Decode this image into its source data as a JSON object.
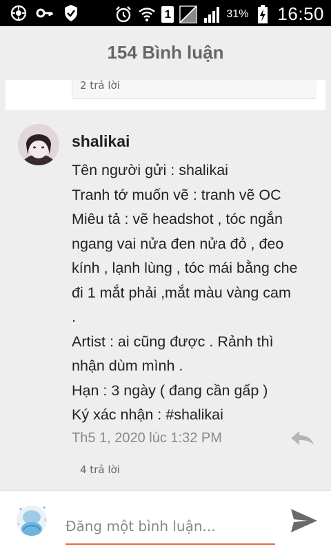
{
  "status_bar": {
    "sim_number": "1",
    "battery": "31%",
    "time": "16:50",
    "icons": [
      "settings-gear-icon",
      "key-icon",
      "shield-check-icon",
      "alarm-icon",
      "wifi-icon",
      "sim-1-icon",
      "no-signal-icon",
      "signal-icon",
      "battery-charging-icon"
    ]
  },
  "header": {
    "title": "154 Bình luận"
  },
  "previous_comment": {
    "reply_count": "2 trả lời"
  },
  "comment": {
    "author": "shalikai",
    "lines": [
      "Tên người gửi : shalikai",
      "Tranh tớ muốn vẽ : tranh vẽ OC",
      "Miêu tả : vẽ headshot , tóc ngắn",
      "ngang vai nửa đen nửa đỏ , đeo",
      "kính , lạnh lùng , tóc mái bằng che",
      "đi 1 mắt phải ,mắt màu vàng cam",
      ".",
      "Artist : ai cũng được . Rảnh thì",
      "nhận dùm mình .",
      "Hạn : 3 ngày ( đang cần gấp )",
      "Ký xác nhận : #shalikai"
    ],
    "timestamp": "Th5 1, 2020 lúc 1:32 PM",
    "reply_count": "4 trả lời",
    "reply_icon": "reply-arrow-icon"
  },
  "compose": {
    "placeholder": "Đăng một bình luận...",
    "send_icon": "send-icon"
  },
  "colors": {
    "accent": "#e76a2e",
    "background": "#eeeeee",
    "status_bar": "#000000"
  }
}
